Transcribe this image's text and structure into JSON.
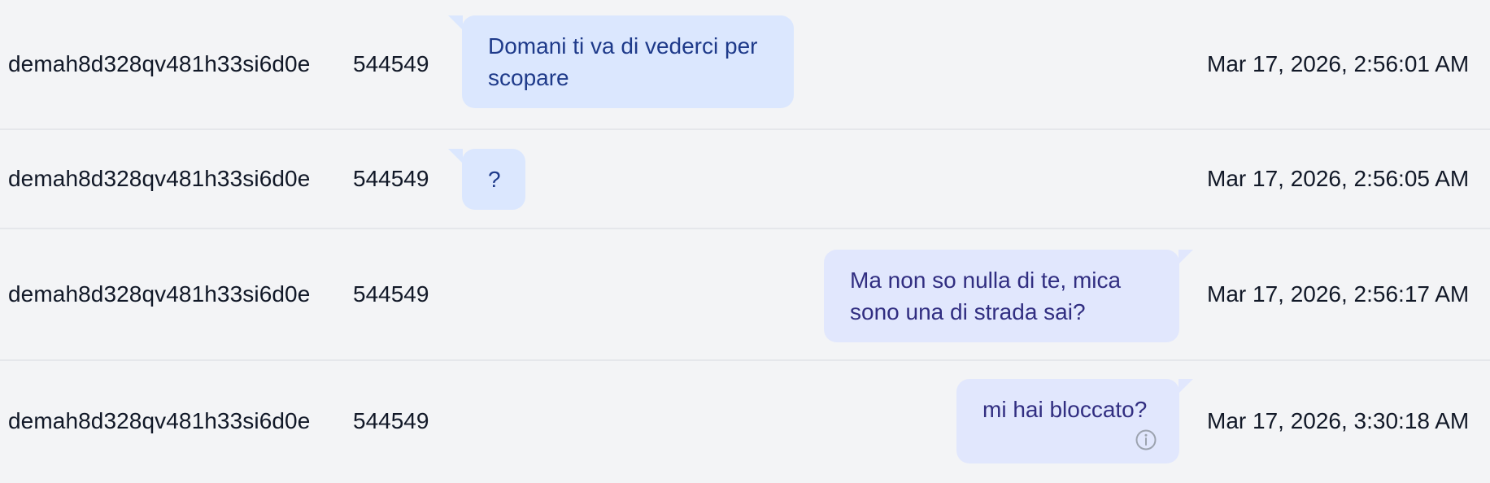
{
  "rows": [
    {
      "sender_id": "demah8d328qv481h33si6d0e",
      "number": "544549",
      "message": "Domani ti va di vederci per scopare",
      "direction": "in",
      "timestamp": "Mar 17, 2026, 2:56:01 AM"
    },
    {
      "sender_id": "demah8d328qv481h33si6d0e",
      "number": "544549",
      "message": "?",
      "direction": "in",
      "timestamp": "Mar 17, 2026, 2:56:05 AM"
    },
    {
      "sender_id": "demah8d328qv481h33si6d0e",
      "number": "544549",
      "message": "Ma non so nulla di te, mica sono una di strada sai?",
      "direction": "out",
      "timestamp": "Mar 17, 2026, 2:56:17 AM"
    },
    {
      "sender_id": "demah8d328qv481h33si6d0e",
      "number": "544549",
      "message": "mi hai bloccato?",
      "direction": "out",
      "timestamp": "Mar 17, 2026, 3:30:18 AM",
      "icon": "info-icon"
    }
  ],
  "colors": {
    "background": "#f3f4f6",
    "row_divider": "#e5e7eb",
    "incoming_bubble": "#dbe7fe",
    "incoming_text": "#1e3a8a",
    "outgoing_bubble": "#e1e7fd",
    "outgoing_text": "#312e81",
    "icon": "#9ca3af"
  }
}
